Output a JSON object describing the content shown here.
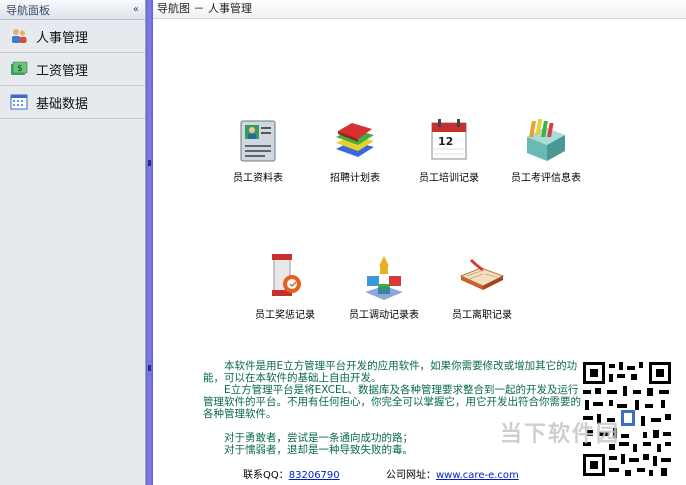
{
  "sidebar": {
    "title": "导航面板",
    "collapse_glyph": "«",
    "items": [
      {
        "label": "人事管理",
        "icon": "people-icon"
      },
      {
        "label": "工资管理",
        "icon": "salary-icon"
      },
      {
        "label": "基础数据",
        "icon": "calendar-grid-icon"
      }
    ]
  },
  "breadcrumb": "导航图 － 人事管理",
  "tiles": [
    {
      "label": "员工资料表",
      "icon": "id-card-icon"
    },
    {
      "label": "招聘计划表",
      "icon": "books-icon"
    },
    {
      "label": "员工培训记录",
      "icon": "calendar-icon",
      "day": "12"
    },
    {
      "label": "员工考评信息表",
      "icon": "file-box-icon"
    },
    {
      "label": "员工奖惩记录",
      "icon": "award-icon"
    },
    {
      "label": "员工调动记录表",
      "icon": "transfer-icon"
    },
    {
      "label": "员工离职记录",
      "icon": "book-open-icon"
    }
  ],
  "description": {
    "p1": "本软件是用E立方管理平台开发的应用软件，如果你需要修改或增加其它的功能，可以在本软件的基础上自由开发。",
    "p2": "E立方管理平台是将EXCEL、数据库及各种管理要求整合到一起的开发及运行管理软件的平台。不用有任何担心，你完全可以掌握它，用它开发出符合你需要的各种管理软件。",
    "p3": "对于勇敢者，尝试是一条通向成功的路；",
    "p4": "对于懦弱者，退却是一种导致失败的毒。"
  },
  "footer": {
    "qq_label": "联系QQ：",
    "qq_value": "83206790",
    "web_label": "公司网址：",
    "web_value": "www.care-e.com"
  },
  "watermark": "当下软件园",
  "colors": {
    "sidebar_bg": "#e6e9ee",
    "splitter": "#6a5fd0",
    "desc_text": "#0a6a48",
    "link": "#0020d0"
  }
}
